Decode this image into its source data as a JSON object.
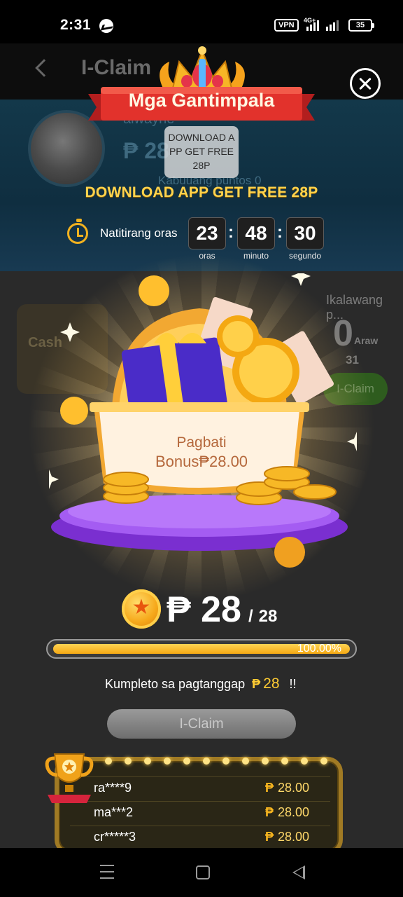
{
  "status_bar": {
    "time": "2:31",
    "vpn": "VPN",
    "network": "4G+",
    "battery": "35"
  },
  "background_app": {
    "title": "I-Claim",
    "username": "alwayne",
    "balance": "₱ 28",
    "points": "Kabuuang puntos  0",
    "card_left": "Cash",
    "right_heading": "Ikalawang p...",
    "days_value": "0",
    "days_label": "Araw",
    "right_timer": "31",
    "right_button": "I-Claim"
  },
  "modal": {
    "banner_title": "Mga Gantimpala",
    "tooltip": "DOWNLOAD APP GET FREE 28P",
    "promo_title": "DOWNLOAD APP GET FREE 28P",
    "timer_label": "Natitirang oras",
    "hours": "23",
    "minutes": "48",
    "seconds": "30",
    "hours_label": "oras",
    "minutes_label": "minuto",
    "seconds_label": "segundo",
    "greeting_line1": "Pagbati",
    "greeting_line2": "Bonus₱28.00",
    "amount_currency": "₱",
    "amount_current": "28",
    "amount_separator": "/",
    "amount_total": "28",
    "progress_fraction": 1.0,
    "progress_text": "100.00%",
    "complete_text": "Kumpleto sa pagtanggap",
    "complete_currency": "₱",
    "complete_value": "28",
    "complete_suffix": "!!",
    "claim_button": "I-Claim",
    "winners": [
      {
        "name": "ra****9",
        "currency": "₱",
        "amount": "28.00"
      },
      {
        "name": "ma***2",
        "currency": "₱",
        "amount": "28.00"
      },
      {
        "name": "cr*****3",
        "currency": "₱",
        "amount": "28.00"
      }
    ]
  },
  "colors": {
    "accent_gold": "#ffd34d",
    "ribbon_red": "#e2322c",
    "progress_fill": "#f4a814",
    "platform_purple": "#8a3fe0"
  }
}
